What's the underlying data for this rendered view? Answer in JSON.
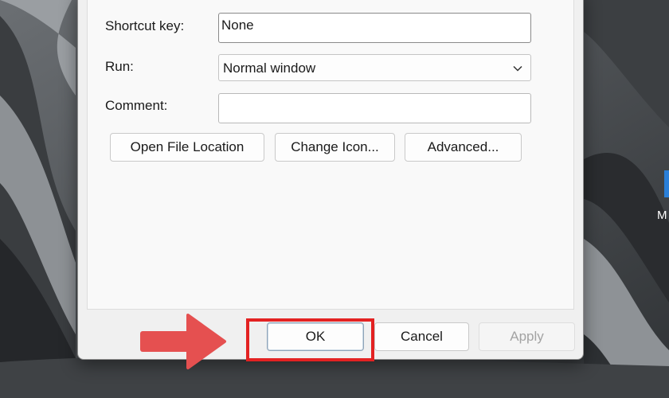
{
  "form": {
    "shortcut_key_label": "Shortcut key:",
    "shortcut_key_value": "None",
    "run_label": "Run:",
    "run_value": "Normal window",
    "comment_label": "Comment:",
    "comment_value": ""
  },
  "actions": {
    "open_file_location": "Open File Location",
    "change_icon": "Change Icon...",
    "advanced": "Advanced..."
  },
  "footer": {
    "ok": "OK",
    "cancel": "Cancel",
    "apply": "Apply"
  },
  "desktop": {
    "icon_label_fragment": "M"
  },
  "colors": {
    "highlight": "#e32222",
    "arrow": "#e55050"
  }
}
